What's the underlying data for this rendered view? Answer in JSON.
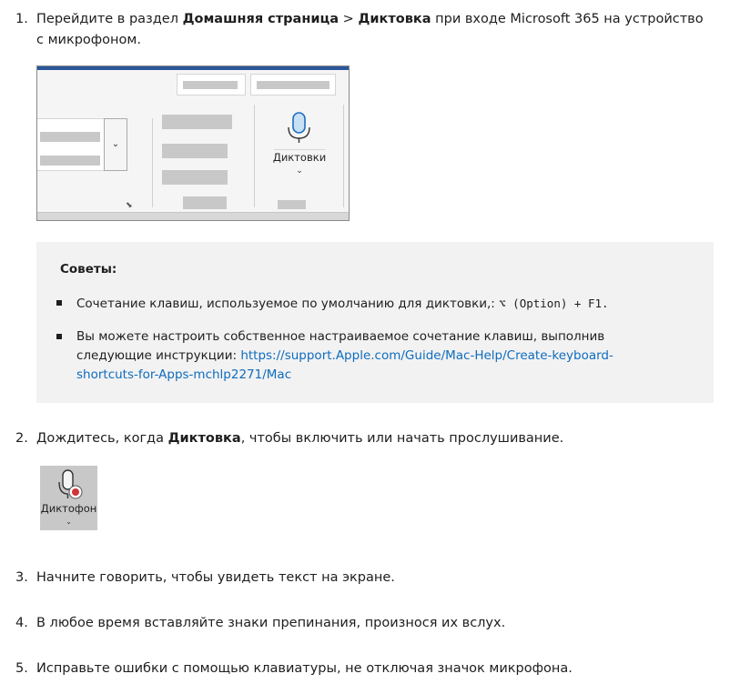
{
  "steps": [
    {
      "number": "1.",
      "pre": "Перейдите в раздел ",
      "bold1": "Домашняя страница",
      "sep": " > ",
      "bold2": "Диктовка",
      "post": " при входе Microsoft 365 на устройство с микрофоном."
    },
    {
      "number": "2.",
      "pre": "Дождитесь, когда ",
      "bold": "Диктовка",
      "post": ", чтобы включить или начать прослушивание."
    },
    {
      "number": "3.",
      "text": "Начните говорить, чтобы увидеть текст на экране."
    },
    {
      "number": "4.",
      "text": "В любое время вставляйте знаки препинания, произнося их вслух."
    },
    {
      "number": "5.",
      "text": "Исправьте ошибки с помощью клавиатуры, не отключая значок микрофона."
    }
  ],
  "ribbon": {
    "dictate_label": "Диктовки",
    "chevron": "⌄",
    "dropdown_chevron": "⌄",
    "corner_glyph": "⬊",
    "accent_color": "#2b579a"
  },
  "tips": {
    "title": "Советы:",
    "item1_text": "Сочетание клавиш, используемое по умолчанию для диктовки,: ",
    "item1_keys": "⌥ (Option) + F1.",
    "item2_text": "Вы можете настроить собственное настраиваемое сочетание клавиш, выполнив следующие инструкции: ",
    "item2_link": "https://support.Apple.com/Guide/Mac-Help/Create-keyboard-shortcuts-for-Apps-mchlp2271/Mac"
  },
  "dictaphone": {
    "label": "Диктофон",
    "chevron": "⌄",
    "record_color": "#d13438"
  }
}
